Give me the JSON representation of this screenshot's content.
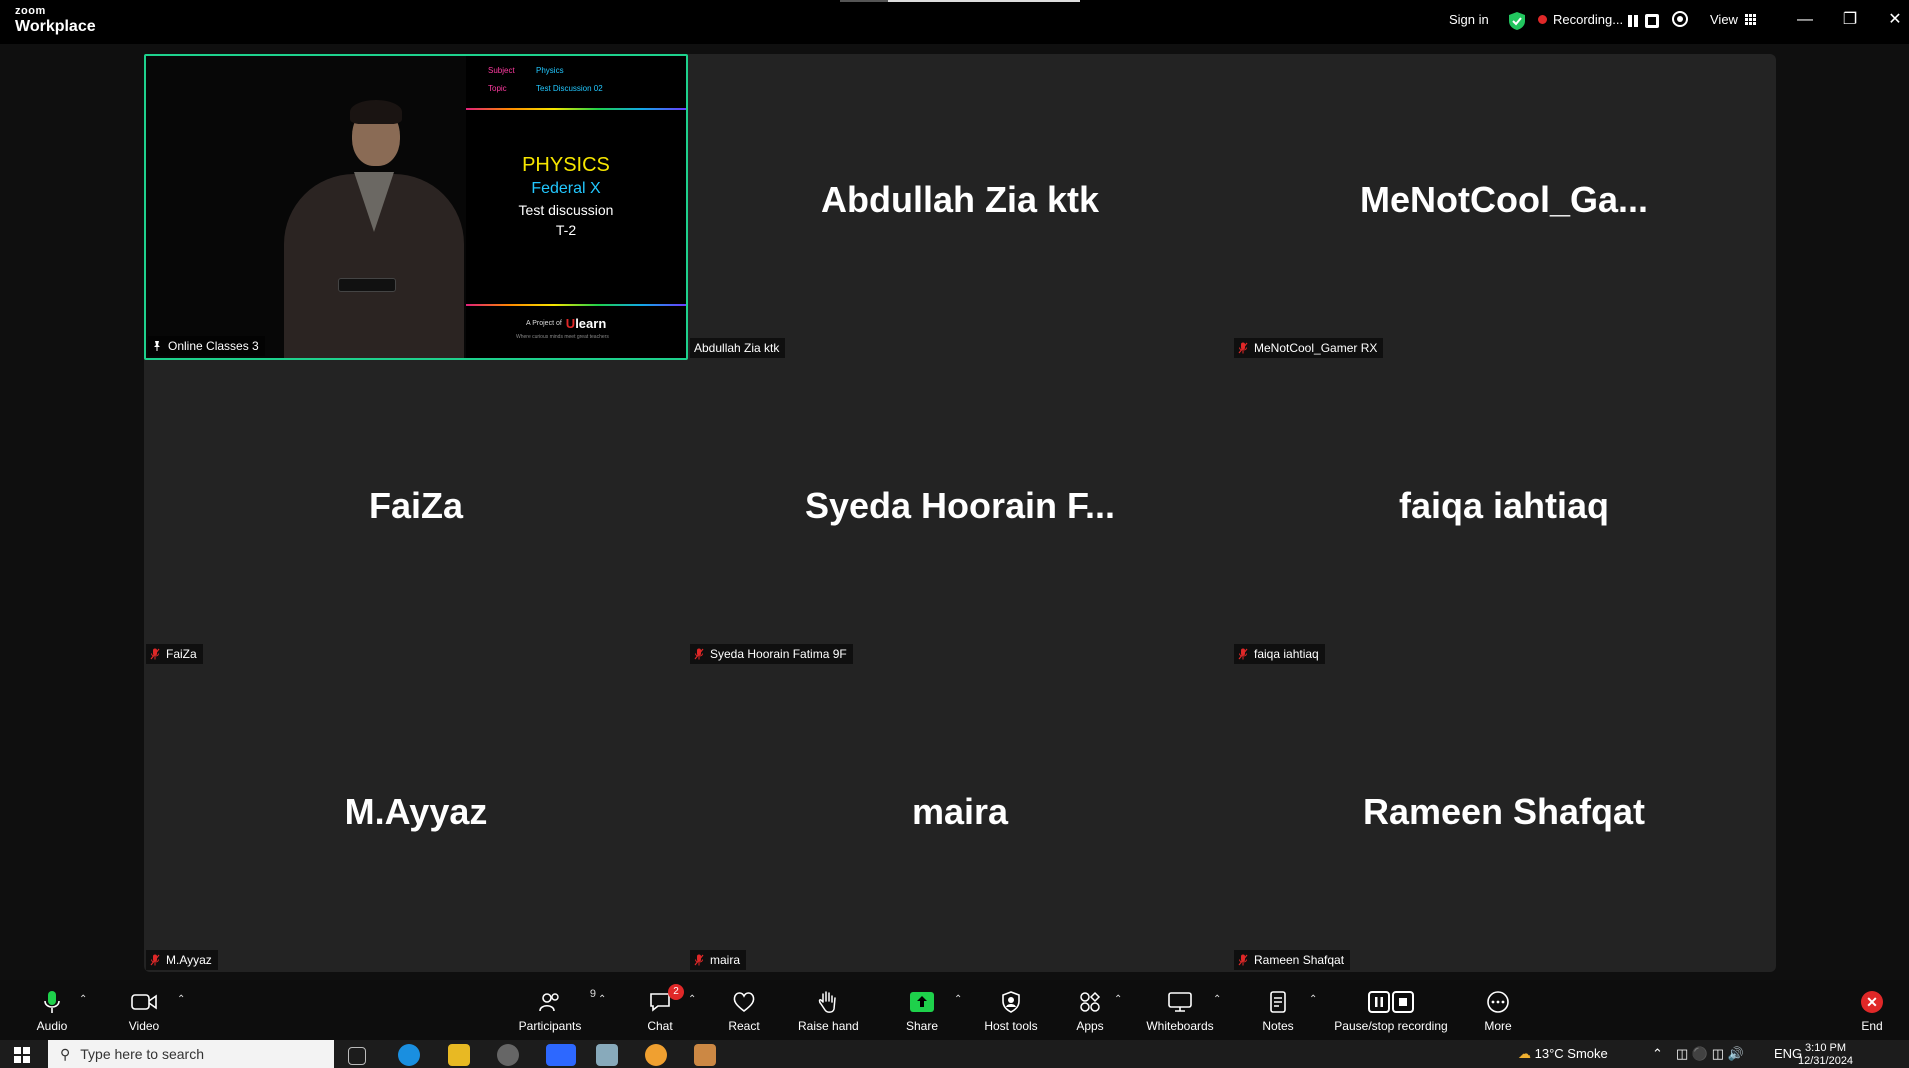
{
  "app": {
    "brand_top": "zoom",
    "brand_bottom": "Workplace"
  },
  "titlebar": {
    "sign_in": "Sign in",
    "recording_label": "Recording...",
    "view_label": "View",
    "window_controls": [
      "minimize-icon",
      "restore-icon",
      "close-icon"
    ]
  },
  "colors": {
    "active_speaker_border": "#1ed18d",
    "recording_red": "#e02828",
    "share_green": "#1ed14b",
    "gallery_bg": "#232323"
  },
  "gallery": {
    "tiles": [
      {
        "display_name": "",
        "label": "Online Classes 3",
        "muted": false,
        "video_on": true
      },
      {
        "display_name": "Abdullah Zia ktk",
        "label": "Abdullah Zia ktk",
        "muted": false,
        "video_on": false
      },
      {
        "display_name": "MeNotCool_Ga...",
        "label": "MeNotCool_Gamer RX",
        "muted": true,
        "video_on": false
      },
      {
        "display_name": "FaiZa",
        "label": "FaiZa",
        "muted": true,
        "video_on": false
      },
      {
        "display_name": "Syeda Hoorain F...",
        "label": "Syeda Hoorain Fatima 9F",
        "muted": true,
        "video_on": false
      },
      {
        "display_name": "faiqa iahtiaq",
        "label": "faiqa iahtiaq",
        "muted": true,
        "video_on": false
      },
      {
        "display_name": "M.Ayyaz",
        "label": "M.Ayyaz",
        "muted": true,
        "video_on": false
      },
      {
        "display_name": "maira",
        "label": "maira",
        "muted": true,
        "video_on": false
      },
      {
        "display_name": "Rameen Shafqat",
        "label": "Rameen Shafqat",
        "muted": true,
        "video_on": false
      }
    ],
    "slide": {
      "subject_label": "Subject",
      "subject_value": "Physics",
      "topic_label": "Topic",
      "topic_value": "Test Discussion 02",
      "title": "PHYSICS",
      "subtitle": "Federal X",
      "line3": "Test discussion",
      "line4": "T-2",
      "project_of": "A Project of",
      "brand": "learn",
      "brand_u": "U",
      "tagline": "Where curious minds meet great teachers"
    }
  },
  "toolbar": {
    "audio": "Audio",
    "video": "Video",
    "participants": "Participants",
    "participants_count": "9",
    "chat": "Chat",
    "chat_badge": "2",
    "react": "React",
    "raise_hand": "Raise hand",
    "share": "Share",
    "host_tools": "Host tools",
    "apps": "Apps",
    "whiteboards": "Whiteboards",
    "notes": "Notes",
    "pause_stop_recording": "Pause/stop recording",
    "more": "More",
    "end": "End"
  },
  "taskbar": {
    "search_placeholder": "Type here to search",
    "weather": "13°C  Smoke",
    "language": "ENG",
    "time": "3:10 PM",
    "date": "12/31/2024"
  }
}
